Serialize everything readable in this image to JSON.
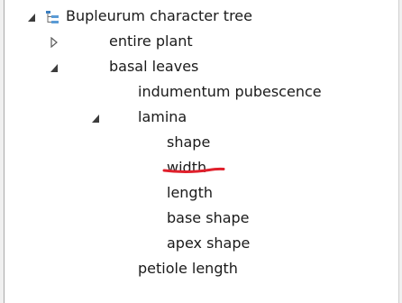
{
  "tree": {
    "root": {
      "label": "Bupleurum character tree",
      "expanded": true,
      "icon": "tree-structure-icon"
    },
    "items": [
      {
        "label": "entire plant",
        "expanded": false
      },
      {
        "label": "basal leaves",
        "expanded": true
      },
      {
        "label": "indumentum pubescence"
      },
      {
        "label": "lamina",
        "expanded": true
      },
      {
        "label": "shape",
        "annotated": true,
        "annotation_color": "#e0202c"
      },
      {
        "label": "width"
      },
      {
        "label": "length"
      },
      {
        "label": "base shape"
      },
      {
        "label": "apex shape"
      },
      {
        "label": "petiole length"
      }
    ]
  },
  "colors": {
    "text": "#1a1a1a",
    "toggle_expanded": "#3c3c3c",
    "toggle_collapsed": "#5a5a5a",
    "annotation": "#e0202c"
  }
}
